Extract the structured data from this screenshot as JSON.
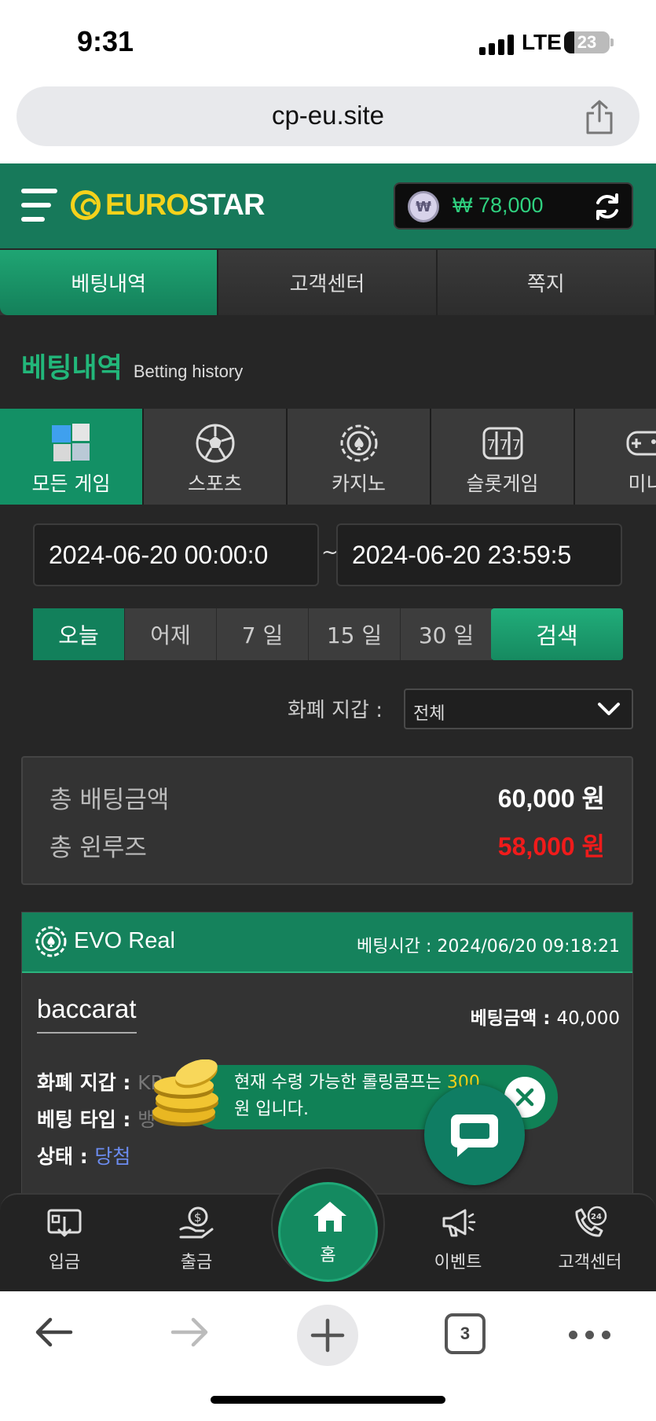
{
  "status_bar": {
    "time": "9:31",
    "network": "LTE",
    "battery": "23",
    "battery_fraction": 0.23
  },
  "browser": {
    "url": "cp-eu.site",
    "tab_count": "3"
  },
  "header": {
    "logo_euro": "EURO",
    "logo_star": "STAR",
    "balance_icon": "₩",
    "balance": "₩ 78,000"
  },
  "top_tabs": [
    {
      "label": "베팅내역",
      "active": true
    },
    {
      "label": "고객센터",
      "active": false
    },
    {
      "label": "쪽지",
      "active": false
    }
  ],
  "section": {
    "title_ko": "베팅내역",
    "title_en": "Betting history"
  },
  "categories": [
    {
      "label": "모든 게임",
      "icon": "all-games-icon",
      "active": true
    },
    {
      "label": "스포츠",
      "icon": "soccer-ball-icon",
      "active": false
    },
    {
      "label": "카지노",
      "icon": "casino-chip-icon",
      "active": false
    },
    {
      "label": "슬롯게임",
      "icon": "slot-machine-icon",
      "active": false
    },
    {
      "label": "미니",
      "icon": "gamepad-icon",
      "active": false
    }
  ],
  "date_range": {
    "start": "2024-06-20 00:00:0",
    "separator": "~",
    "end": "2024-06-20 23:59:5"
  },
  "quick_ranges": [
    {
      "label": "오늘",
      "active": true
    },
    {
      "label": "어제",
      "active": false
    },
    {
      "label": "7 일",
      "active": false
    },
    {
      "label": "15 일",
      "active": false
    },
    {
      "label": "30 일",
      "active": false
    }
  ],
  "search_label": "검색",
  "wallet_filter": {
    "label": "화폐 지갑 :",
    "value": "전체"
  },
  "summary": {
    "total_bet_label": "총 배팅금액",
    "total_bet_value": "60,000 원",
    "total_winloss_label": "총 윈루즈",
    "total_winloss_value": "58,000 원"
  },
  "bet_card": {
    "provider": "EVO Real",
    "bet_time": "베팅시간 : 2024/06/20 09:18:21",
    "game_name": "baccarat",
    "bet_amount_label": "베팅금액 :",
    "bet_amount_value": "40,000",
    "wallet_label": "화폐 지갑 :",
    "wallet_value": "KR",
    "type_label": "베팅 타입 :",
    "type_value": "뱅",
    "status_label": "상태 :",
    "status_value": "당첨"
  },
  "promo_toast": {
    "line1": "현재 수령 가능한 롤링콤프는",
    "amount": "300",
    "line2": "원 입니다."
  },
  "bottom_nav": [
    {
      "label": "입금",
      "icon": "deposit-icon"
    },
    {
      "label": "출금",
      "icon": "withdraw-icon"
    },
    {
      "label": "홈",
      "icon": "home-icon"
    },
    {
      "label": "이벤트",
      "icon": "megaphone-icon"
    },
    {
      "label": "고객센터",
      "icon": "support-24-icon"
    }
  ],
  "colors": {
    "brand_green": "#17795a",
    "accent_yellow": "#f4d21b",
    "loss_red": "#f01b1b"
  }
}
